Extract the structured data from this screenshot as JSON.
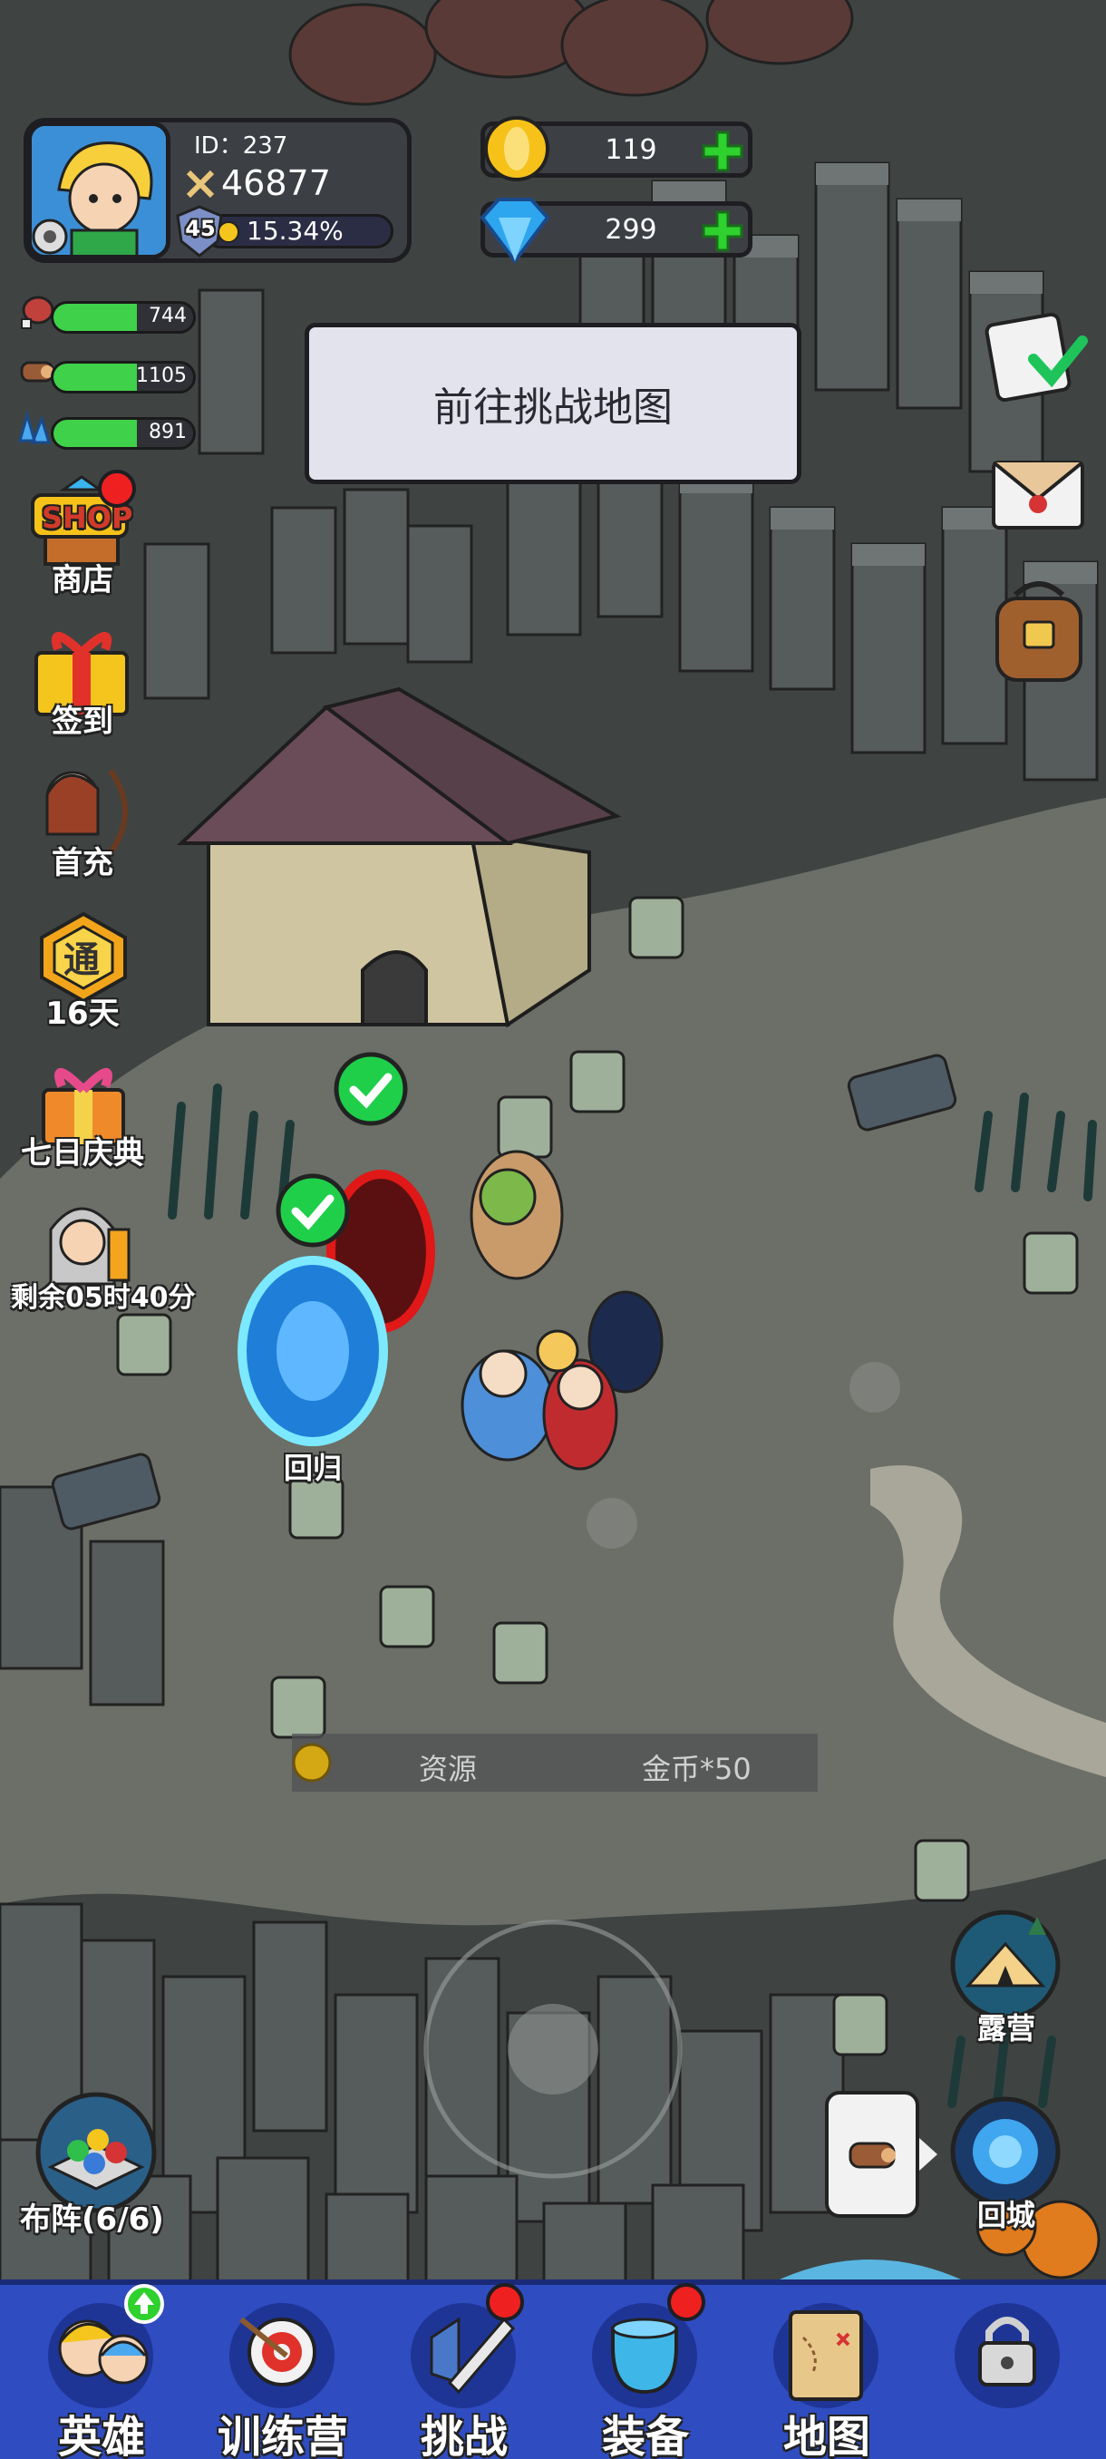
{
  "player": {
    "id_label": "ID：237",
    "power": "46877",
    "level": "45",
    "exp_percent": "15.34%",
    "exp_fraction": 0.1534
  },
  "currency": {
    "gold": "119",
    "diamonds": "299"
  },
  "resources": [
    {
      "icon": "meat-icon",
      "value": "744",
      "fill": 0.6
    },
    {
      "icon": "wood-icon",
      "value": "1105",
      "fill": 0.6
    },
    {
      "icon": "crystal-icon",
      "value": "891",
      "fill": 0.6
    }
  ],
  "challenge_button": {
    "label": "前往挑战地图"
  },
  "left_menu": {
    "shop": "商店",
    "shop_badge": "SHOP",
    "checkin": "签到",
    "first_recharge": "首充",
    "pass_days": "16天",
    "pass_badge": "通",
    "seven_day": "七日庆典",
    "timer": "剩余05时40分"
  },
  "map": {
    "portal_label": "回归",
    "camp_label": "露营",
    "return_city_label": "回城",
    "formation_label": "布阵(6/6)"
  },
  "pickup": {
    "label": "资源",
    "value": "金币*50"
  },
  "bottom_nav": [
    {
      "label": "英雄",
      "icon": "heroes-icon"
    },
    {
      "label": "训练营",
      "icon": "training-camp-icon"
    },
    {
      "label": "挑战",
      "icon": "challenge-sword-icon"
    },
    {
      "label": "装备",
      "icon": "equipment-icon"
    },
    {
      "label": "地图",
      "icon": "map-scroll-icon"
    },
    {
      "label": "",
      "icon": "locked-icon"
    }
  ],
  "colors": {
    "nav_bg": "#2f4cc0",
    "resource_fill": "#3fd14a",
    "plus_green": "#2ed12e",
    "badge_red": "#ef2020"
  }
}
